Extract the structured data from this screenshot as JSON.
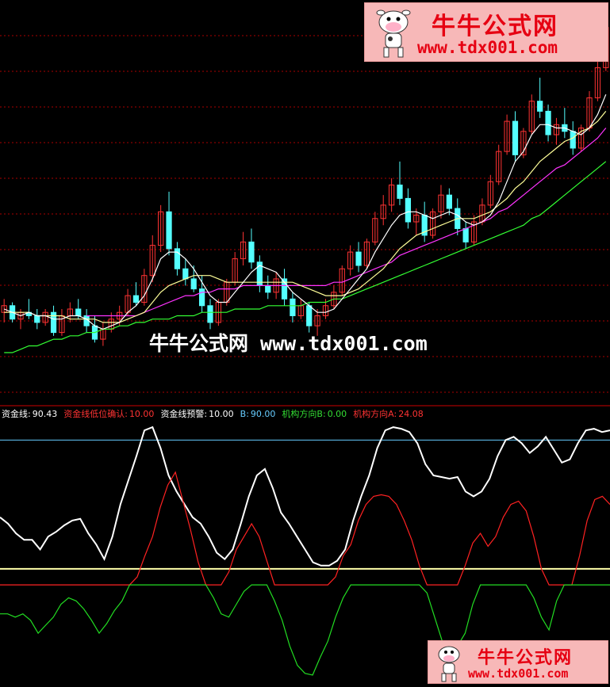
{
  "watermark": {
    "brand": "牛牛公式网",
    "url": "www.tdx001.com",
    "center_text": "牛牛公式网 www.tdx001.com"
  },
  "legend": [
    {
      "label": "资金线:",
      "value": "90.43",
      "label_color": "#ffffff",
      "value_color": "#ffffff"
    },
    {
      "label": "资金线低位确认:",
      "value": "10.00",
      "label_color": "#ff3333",
      "value_color": "#ff3333"
    },
    {
      "label": "资金线预警:",
      "value": "10.00",
      "label_color": "#ffffff",
      "value_color": "#ffffff"
    },
    {
      "label": "B:",
      "value": "90.00",
      "label_color": "#66ccff",
      "value_color": "#66ccff"
    },
    {
      "label": "机构方向B:",
      "value": "0.00",
      "label_color": "#33dd33",
      "value_color": "#33dd33"
    },
    {
      "label": "机构方向A:",
      "value": "24.08",
      "label_color": "#ff3333",
      "value_color": "#ff3333"
    }
  ],
  "colors": {
    "background": "#000000",
    "up": "#ff3333",
    "down": "#54ffff",
    "ma_short": "#ffffff",
    "ma_mid": "#ffff99",
    "ma_long1": "#ff33ff",
    "ma_long2": "#33ff33",
    "grid": "#aa0000",
    "fund_line": "#ffffff",
    "inst_A": "#ff2222",
    "inst_B": "#22dd22",
    "line_90": "#66ccff",
    "line_10": "#ffffaa"
  },
  "chart_data": [
    {
      "type": "candlestick",
      "grid": true,
      "candles": [
        [
          28.5,
          28.9,
          28.2,
          28.7
        ],
        [
          28.7,
          28.8,
          28.2,
          28.3
        ],
        [
          28.3,
          28.6,
          28.0,
          28.5
        ],
        [
          28.5,
          28.9,
          28.3,
          28.4
        ],
        [
          28.4,
          28.6,
          28.0,
          28.2
        ],
        [
          28.2,
          28.6,
          28.1,
          28.5
        ],
        [
          28.5,
          28.7,
          27.8,
          27.9
        ],
        [
          27.9,
          28.6,
          27.8,
          28.4
        ],
        [
          28.4,
          28.8,
          28.2,
          28.6
        ],
        [
          28.6,
          28.9,
          28.3,
          28.4
        ],
        [
          28.4,
          28.6,
          27.9,
          28.1
        ],
        [
          28.1,
          28.4,
          27.6,
          27.7
        ],
        [
          27.7,
          28.2,
          27.5,
          28.0
        ],
        [
          28.0,
          28.5,
          27.9,
          28.3
        ],
        [
          28.3,
          28.7,
          28.1,
          28.5
        ],
        [
          28.5,
          29.2,
          28.4,
          29.0
        ],
        [
          29.0,
          29.4,
          28.7,
          28.8
        ],
        [
          28.8,
          29.8,
          28.7,
          29.6
        ],
        [
          29.6,
          30.8,
          29.4,
          30.5
        ],
        [
          30.5,
          31.7,
          30.3,
          31.5
        ],
        [
          31.5,
          32.1,
          30.2,
          30.4
        ],
        [
          30.4,
          30.6,
          29.6,
          29.8
        ],
        [
          29.8,
          30.1,
          29.3,
          29.5
        ],
        [
          29.5,
          29.9,
          29.1,
          29.2
        ],
        [
          29.2,
          29.6,
          28.5,
          28.7
        ],
        [
          28.7,
          28.9,
          28.0,
          28.2
        ],
        [
          28.2,
          28.9,
          28.1,
          28.8
        ],
        [
          28.8,
          29.5,
          28.7,
          29.4
        ],
        [
          29.4,
          30.3,
          29.3,
          30.1
        ],
        [
          30.1,
          30.9,
          29.9,
          30.6
        ],
        [
          30.6,
          31.0,
          29.8,
          30.0
        ],
        [
          30.0,
          30.2,
          29.1,
          29.3
        ],
        [
          29.3,
          29.6,
          28.9,
          29.1
        ],
        [
          29.1,
          29.7,
          28.9,
          29.5
        ],
        [
          29.5,
          29.8,
          28.7,
          28.9
        ],
        [
          28.9,
          29.1,
          28.2,
          28.4
        ],
        [
          28.4,
          28.9,
          28.3,
          28.7
        ],
        [
          28.7,
          28.8,
          27.9,
          28.1
        ],
        [
          28.1,
          28.6,
          27.8,
          28.4
        ],
        [
          28.4,
          28.9,
          28.3,
          28.7
        ],
        [
          28.7,
          29.3,
          28.6,
          29.1
        ],
        [
          29.1,
          29.9,
          29.0,
          29.8
        ],
        [
          29.8,
          30.5,
          29.6,
          30.3
        ],
        [
          30.3,
          30.6,
          29.7,
          29.9
        ],
        [
          29.9,
          30.7,
          29.8,
          30.6
        ],
        [
          30.6,
          31.5,
          30.5,
          31.3
        ],
        [
          31.3,
          32.0,
          31.1,
          31.7
        ],
        [
          31.7,
          32.5,
          31.5,
          32.3
        ],
        [
          32.3,
          33.0,
          31.7,
          31.9
        ],
        [
          31.9,
          32.2,
          31.0,
          31.2
        ],
        [
          31.2,
          31.6,
          30.8,
          31.4
        ],
        [
          31.4,
          31.8,
          30.6,
          30.8
        ],
        [
          30.8,
          31.6,
          30.7,
          31.5
        ],
        [
          31.5,
          32.3,
          31.3,
          32.0
        ],
        [
          32.0,
          32.2,
          31.4,
          31.6
        ],
        [
          31.6,
          31.9,
          30.8,
          31.0
        ],
        [
          31.0,
          31.2,
          30.4,
          30.6
        ],
        [
          30.6,
          31.4,
          30.5,
          31.2
        ],
        [
          31.2,
          31.9,
          31.1,
          31.7
        ],
        [
          31.7,
          32.6,
          31.6,
          32.4
        ],
        [
          32.4,
          33.5,
          32.3,
          33.3
        ],
        [
          33.3,
          34.4,
          33.2,
          34.2
        ],
        [
          34.2,
          34.5,
          33.0,
          33.2
        ],
        [
          33.2,
          34.0,
          33.1,
          33.9
        ],
        [
          33.9,
          35.0,
          33.8,
          34.8
        ],
        [
          34.8,
          35.5,
          34.3,
          34.5
        ],
        [
          34.5,
          34.7,
          33.6,
          33.8
        ],
        [
          33.8,
          34.3,
          33.5,
          34.1
        ],
        [
          34.1,
          34.6,
          33.7,
          33.9
        ],
        [
          33.9,
          34.2,
          33.2,
          33.4
        ],
        [
          33.4,
          34.1,
          33.3,
          34.0
        ],
        [
          34.0,
          35.1,
          33.9,
          34.9
        ],
        [
          34.9,
          36.0,
          34.8,
          35.8
        ],
        [
          35.8,
          37.2,
          35.7,
          37.0
        ]
      ],
      "ma_short": [
        28.6,
        28.5,
        28.4,
        28.5,
        28.4,
        28.4,
        28.3,
        28.3,
        28.4,
        28.4,
        28.3,
        28.1,
        28.0,
        28.1,
        28.2,
        28.5,
        28.7,
        29.0,
        29.5,
        30.1,
        30.3,
        30.3,
        30.1,
        29.8,
        29.4,
        29.0,
        28.8,
        28.8,
        29.1,
        29.4,
        29.7,
        29.9,
        29.8,
        29.7,
        29.4,
        29.1,
        28.9,
        28.7,
        28.5,
        28.5,
        28.6,
        28.9,
        29.2,
        29.5,
        29.8,
        30.3,
        30.7,
        31.1,
        31.4,
        31.5,
        31.5,
        31.4,
        31.3,
        31.4,
        31.5,
        31.4,
        31.2,
        31.1,
        31.2,
        31.4,
        31.8,
        32.4,
        33.0,
        33.3,
        33.8,
        34.1,
        34.1,
        34.0,
        34.0,
        33.9,
        33.8,
        34.0,
        34.4,
        35.0
      ],
      "ma_mid": [
        28.5,
        28.5,
        28.5,
        28.5,
        28.4,
        28.4,
        28.4,
        28.4,
        28.3,
        28.3,
        28.3,
        28.3,
        28.2,
        28.2,
        28.2,
        28.3,
        28.4,
        28.5,
        28.8,
        29.1,
        29.3,
        29.4,
        29.5,
        29.6,
        29.6,
        29.6,
        29.5,
        29.4,
        29.4,
        29.4,
        29.4,
        29.4,
        29.4,
        29.4,
        29.4,
        29.4,
        29.3,
        29.2,
        29.1,
        29.0,
        29.0,
        29.0,
        29.1,
        29.2,
        29.4,
        29.6,
        29.8,
        30.1,
        30.4,
        30.6,
        30.8,
        30.9,
        31.0,
        31.1,
        31.2,
        31.3,
        31.3,
        31.3,
        31.4,
        31.5,
        31.7,
        31.9,
        32.2,
        32.4,
        32.7,
        33.0,
        33.2,
        33.4,
        33.6,
        33.7,
        33.9,
        34.0,
        34.2,
        34.5
      ],
      "ma_long1": [
        null,
        null,
        null,
        null,
        null,
        null,
        null,
        null,
        null,
        null,
        28.4,
        28.4,
        28.4,
        28.4,
        28.4,
        28.4,
        28.4,
        28.5,
        28.6,
        28.7,
        28.8,
        28.9,
        29.0,
        29.0,
        29.1,
        29.1,
        29.2,
        29.2,
        29.2,
        29.3,
        29.3,
        29.3,
        29.3,
        29.3,
        29.3,
        29.3,
        29.3,
        29.3,
        29.3,
        29.3,
        29.4,
        29.4,
        29.5,
        29.6,
        29.7,
        29.8,
        29.9,
        30.0,
        30.2,
        30.3,
        30.4,
        30.5,
        30.6,
        30.7,
        30.8,
        30.9,
        31.0,
        31.1,
        31.2,
        31.3,
        31.5,
        31.6,
        31.8,
        32.0,
        32.2,
        32.4,
        32.6,
        32.8,
        32.9,
        33.1,
        33.3,
        33.5,
        33.7,
        34.0
      ],
      "ma_long2": [
        27.3,
        27.3,
        27.4,
        27.5,
        27.5,
        27.6,
        27.7,
        27.7,
        27.8,
        27.8,
        27.9,
        27.9,
        28.0,
        28.0,
        28.1,
        28.1,
        28.2,
        28.2,
        28.3,
        28.3,
        28.3,
        28.4,
        28.4,
        28.4,
        28.5,
        28.5,
        28.5,
        28.5,
        28.6,
        28.6,
        28.6,
        28.6,
        28.7,
        28.7,
        28.7,
        28.7,
        28.7,
        28.8,
        28.8,
        28.8,
        28.9,
        28.9,
        29.0,
        29.1,
        29.2,
        29.3,
        29.4,
        29.5,
        29.6,
        29.7,
        29.8,
        29.9,
        30.0,
        30.1,
        30.2,
        30.3,
        30.4,
        30.5,
        30.6,
        30.7,
        30.8,
        30.9,
        31.0,
        31.1,
        31.3,
        31.4,
        31.6,
        31.8,
        32.0,
        32.2,
        32.4,
        32.6,
        32.8,
        33.0
      ]
    },
    {
      "type": "line",
      "series": [
        {
          "name": "资金线",
          "values": [
            42,
            38,
            32,
            28,
            28,
            22,
            30,
            33,
            37,
            40,
            41,
            32,
            25,
            16,
            30,
            50,
            65,
            80,
            96,
            98,
            85,
            68,
            58,
            50,
            42,
            38,
            30,
            20,
            16,
            22,
            38,
            55,
            68,
            72,
            60,
            45,
            38,
            30,
            22,
            14,
            12,
            12,
            15,
            22,
            40,
            55,
            68,
            85,
            96,
            98,
            97,
            95,
            88,
            75,
            68,
            67,
            66,
            67,
            58,
            55,
            58,
            66,
            80,
            90,
            92,
            88,
            82,
            86,
            92,
            84,
            76,
            78,
            88,
            96,
            97,
            95,
            96
          ]
        },
        {
          "name": "机构方向A",
          "values": [
            0,
            0,
            0,
            0,
            0,
            0,
            0,
            0,
            0,
            0,
            0,
            0,
            0,
            0,
            0,
            0,
            0,
            0,
            5,
            18,
            30,
            48,
            62,
            70,
            52,
            34,
            14,
            0,
            0,
            0,
            8,
            22,
            30,
            38,
            30,
            15,
            0,
            0,
            0,
            0,
            0,
            0,
            0,
            0,
            5,
            18,
            25,
            40,
            50,
            55,
            56,
            55,
            50,
            40,
            28,
            12,
            0,
            0,
            0,
            0,
            0,
            12,
            26,
            32,
            24,
            30,
            42,
            50,
            52,
            46,
            30,
            10,
            0,
            0,
            0,
            0,
            18,
            40,
            53,
            55,
            50
          ]
        },
        {
          "name": "机构方向B",
          "values": [
            -18,
            -18,
            -20,
            -18,
            -22,
            -30,
            -25,
            -20,
            -12,
            -8,
            -10,
            -15,
            -22,
            -30,
            -24,
            -16,
            -10,
            0,
            0,
            0,
            0,
            0,
            0,
            0,
            0,
            0,
            0,
            0,
            -8,
            -18,
            -20,
            -12,
            -4,
            0,
            0,
            0,
            -10,
            -22,
            -38,
            -50,
            -55,
            -56,
            -45,
            -35,
            -20,
            -8,
            0,
            0,
            0,
            0,
            0,
            0,
            0,
            0,
            0,
            0,
            -5,
            -20,
            -35,
            -40,
            -38,
            -30,
            -12,
            0,
            0,
            0,
            0,
            0,
            0,
            0,
            -8,
            -20,
            -28,
            -10,
            0,
            0,
            0,
            0,
            0,
            0,
            0
          ]
        }
      ],
      "reference_lines": {
        "B": 90,
        "资金线预警": 10
      }
    }
  ]
}
